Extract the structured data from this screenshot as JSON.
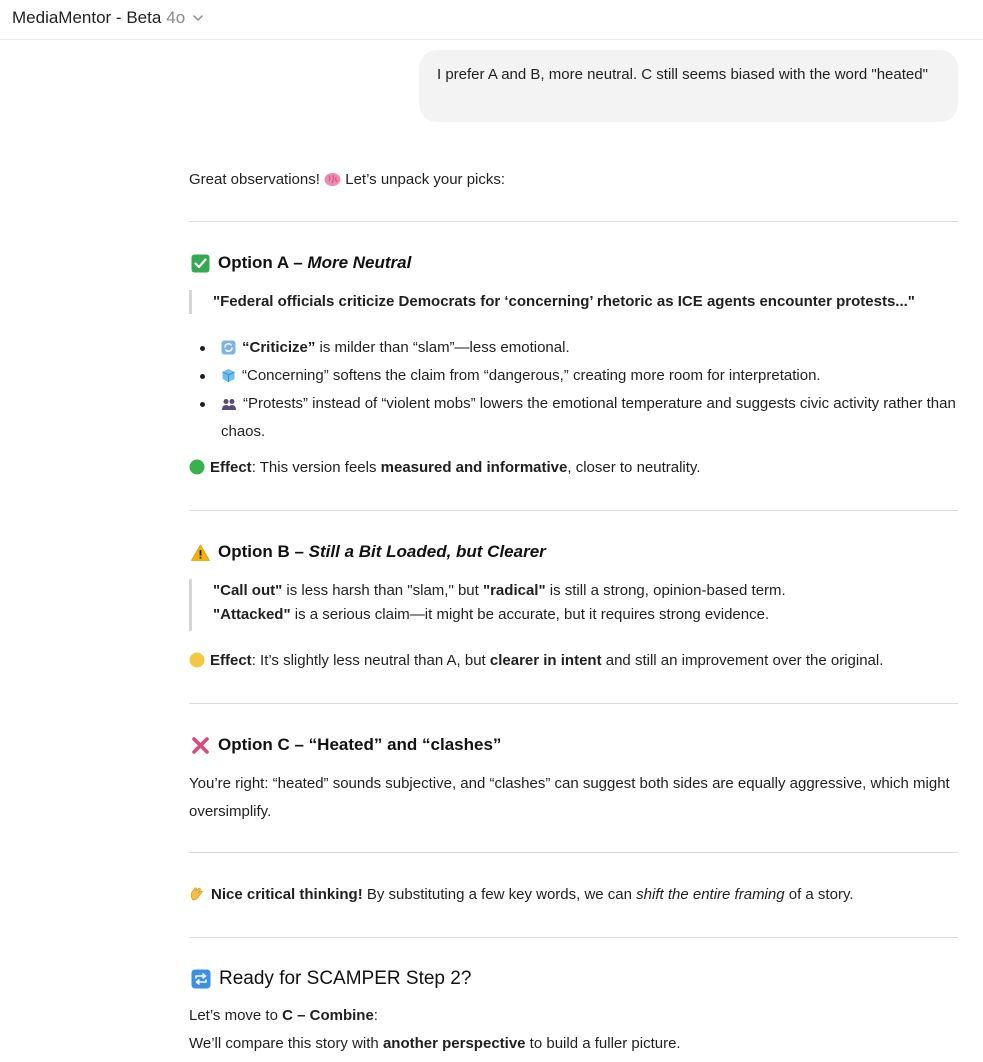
{
  "app": {
    "title": "MediaMentor - Beta",
    "model": "4o"
  },
  "user_message": "I prefer A and B, more neutral. C still seems biased with the word \"heated\"",
  "intro": {
    "a": "Great observations! ",
    "b": " Let’s unpack your picks:"
  },
  "option_a": {
    "title_a": "Option A – ",
    "title_b": "More Neutral",
    "quote": "\"Federal officials criticize Democrats for ‘concerning’ rhetoric as ICE agents encounter protests...\"",
    "bullets": [
      {
        "bold": "“Criticize”",
        "rest": " is milder than “slam”—less emotional."
      },
      {
        "plain": "“Concerning” softens the claim from “dangerous,” creating more room for interpretation."
      },
      {
        "plain": "“Protests” instead of “violent mobs” lowers the emotional temperature and suggests civic activity rather than chaos."
      }
    ],
    "effect_label": "Effect",
    "effect_a": ": This version feels ",
    "effect_bold": "measured and informative",
    "effect_b": ", closer to neutrality."
  },
  "option_b": {
    "title_a": "Option B – ",
    "title_b": "Still a Bit Loaded, but Clearer",
    "q1_bold": "\"Call out\"",
    "q1_a": " is less harsh than \"slam,\" but ",
    "q1_bold2": "\"radical\"",
    "q1_b": " is still a strong, opinion-based term.",
    "q2_bold": "\"Attacked\"",
    "q2_a": " is a serious claim—it might be accurate, but it requires strong evidence.",
    "effect_label": "Effect",
    "effect_a": ": It’s slightly less neutral than A, but ",
    "effect_bold": "clearer in intent",
    "effect_b": " and still an improvement over the original."
  },
  "option_c": {
    "title": "Option C – “Heated” and “clashes”",
    "body": "You’re right: “heated” sounds subjective, and “clashes” can suggest both sides are equally aggressive, which might oversimplify."
  },
  "praise": {
    "bold": "Nice critical thinking!",
    "a": " By substituting a few key words, we can ",
    "italic": "shift the entire framing",
    "b": " of a story."
  },
  "next_step": {
    "title": "Ready for SCAMPER Step 2?",
    "l1_a": "Let’s move to ",
    "l1_bold": "C – Combine",
    "l1_b": ":",
    "l2_a": "We’ll compare this story with ",
    "l2_bold": "another perspective",
    "l2_b": " to build a fuller picture."
  },
  "colors": {
    "check": "#34a853",
    "warning": "#f5b400",
    "cross": "#e0457b",
    "green_dot": "#37b24d",
    "yellow_dot": "#f2c744",
    "repeat": "#3b8fe6"
  }
}
